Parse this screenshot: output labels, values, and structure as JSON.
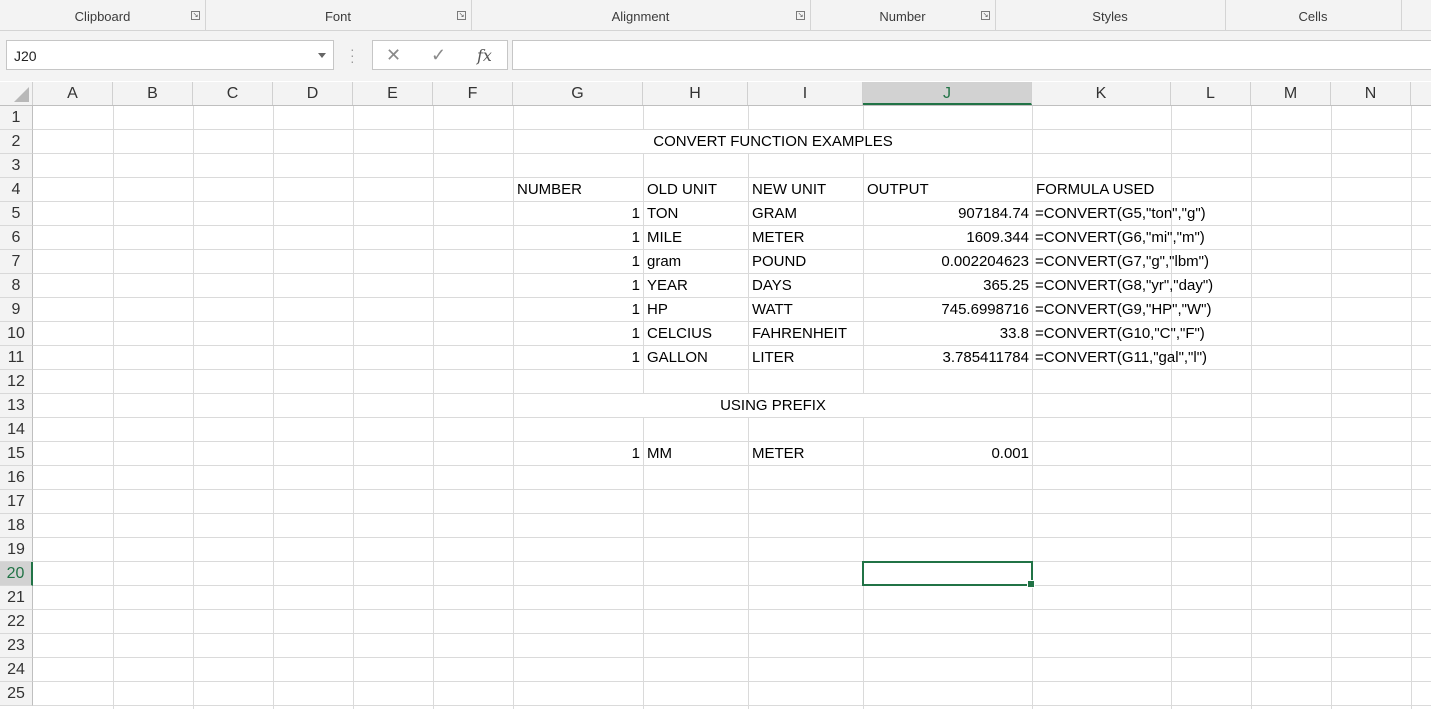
{
  "ribbon": {
    "groups": [
      {
        "label": "Clipboard"
      },
      {
        "label": "Font"
      },
      {
        "label": "Alignment"
      },
      {
        "label": "Number"
      },
      {
        "label": "Styles"
      },
      {
        "label": "Cells"
      }
    ]
  },
  "formula_bar": {
    "name_box": "J20",
    "cancel_glyph": "✕",
    "enter_glyph": "✓",
    "fx_glyph": "fx",
    "formula": ""
  },
  "sheet": {
    "columns": [
      "A",
      "B",
      "C",
      "D",
      "E",
      "F",
      "G",
      "H",
      "I",
      "J",
      "K",
      "L",
      "M",
      "N"
    ],
    "selected_column": "J",
    "rows": [
      "1",
      "2",
      "3",
      "4",
      "5",
      "6",
      "7",
      "8",
      "9",
      "10",
      "11",
      "12",
      "13",
      "14",
      "15",
      "16",
      "17",
      "18",
      "19",
      "20",
      "21",
      "22",
      "23",
      "24",
      "25"
    ],
    "selected_row": "20",
    "title": "CONVERT FUNCTION EXAMPLES",
    "headers": {
      "number": "NUMBER",
      "old_unit": "OLD UNIT",
      "new_unit": "NEW UNIT",
      "output": "OUTPUT",
      "formula": "FORMULA USED"
    },
    "data_rows": [
      {
        "number": "1",
        "old_unit": "TON",
        "new_unit": "GRAM",
        "output": "907184.74",
        "formula": "=CONVERT(G5,\"ton\",\"g\")"
      },
      {
        "number": "1",
        "old_unit": "MILE",
        "new_unit": "METER",
        "output": "1609.344",
        "formula": "=CONVERT(G6,\"mi\",\"m\")"
      },
      {
        "number": "1",
        "old_unit": "gram",
        "new_unit": "POUND",
        "output": "0.002204623",
        "formula": "=CONVERT(G7,\"g\",\"lbm\")"
      },
      {
        "number": "1",
        "old_unit": "YEAR",
        "new_unit": "DAYS",
        "output": "365.25",
        "formula": "=CONVERT(G8,\"yr\",\"day\")"
      },
      {
        "number": "1",
        "old_unit": "HP",
        "new_unit": "WATT",
        "output": "745.6998716",
        "formula": "=CONVERT(G9,\"HP\",\"W\")"
      },
      {
        "number": "1",
        "old_unit": "CELCIUS",
        "new_unit": "FAHRENHEIT",
        "output": "33.8",
        "formula": "=CONVERT(G10,\"C\",\"F\")"
      },
      {
        "number": "1",
        "old_unit": "GALLON",
        "new_unit": "LITER",
        "output": "3.785411784",
        "formula": "=CONVERT(G11,\"gal\",\"l\")"
      }
    ],
    "prefix_title": "USING PREFIX",
    "prefix_row": {
      "number": "1",
      "old_unit": "MM",
      "new_unit": "METER",
      "output": "0.001"
    },
    "active_cell": "J20"
  }
}
